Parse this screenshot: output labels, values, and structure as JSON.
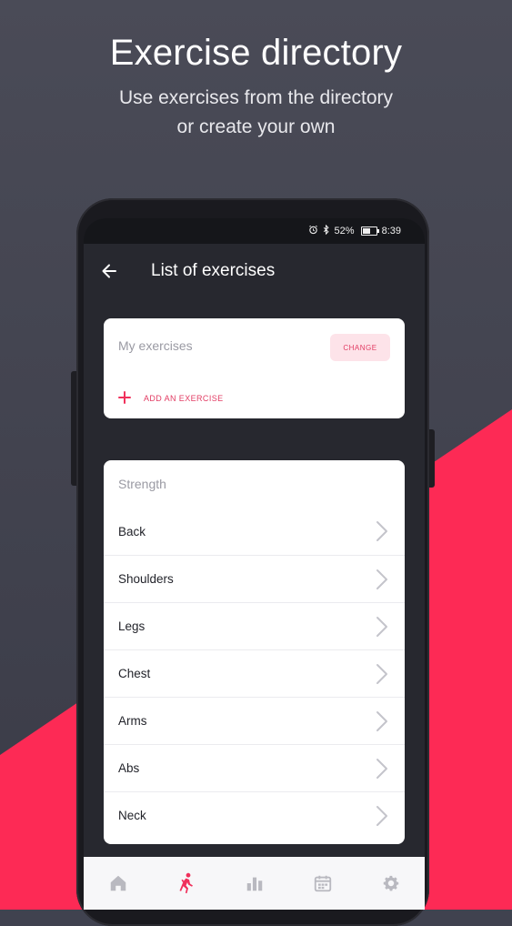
{
  "promo": {
    "title": "Exercise directory",
    "subtitle_line1": "Use exercises from the directory",
    "subtitle_line2": "or create your own"
  },
  "status_bar": {
    "battery_percent": "52%",
    "time": "8:39"
  },
  "app_bar": {
    "title": "List of exercises"
  },
  "my_exercises": {
    "label": "My exercises",
    "change_label": "CHANGE",
    "add_label": "ADD AN EXERCISE"
  },
  "strength": {
    "header": "Strength",
    "items": [
      {
        "label": "Back"
      },
      {
        "label": "Shoulders"
      },
      {
        "label": "Legs"
      },
      {
        "label": "Chest"
      },
      {
        "label": "Arms"
      },
      {
        "label": "Abs"
      },
      {
        "label": "Neck"
      }
    ]
  },
  "bottom_nav": {
    "items": [
      "home-icon",
      "workout-icon",
      "stats-icon",
      "calendar-icon",
      "settings-icon"
    ],
    "active": "workout-icon"
  },
  "colors": {
    "accent": "#fd2a55",
    "background_dark": "#40424f",
    "screen_background": "#27282f"
  }
}
